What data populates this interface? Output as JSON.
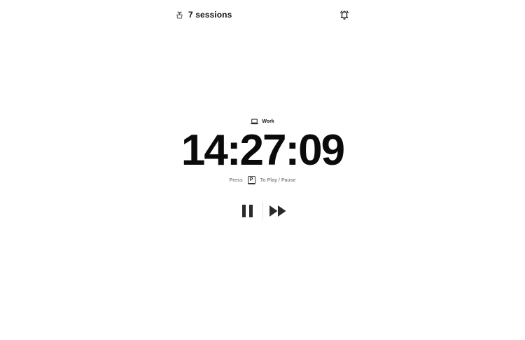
{
  "header": {
    "sessions_label": "7 sessions",
    "sessions_icon": "sprout-pot-icon",
    "notification_icon": "bell-ringing-icon"
  },
  "mode": {
    "label": "Work",
    "icon": "laptop-icon"
  },
  "timer": {
    "display": "14:27:09"
  },
  "hint": {
    "prefix": "Press",
    "key": "P",
    "suffix": "To Play / Pause"
  },
  "controls": {
    "pause_icon": "pause-icon",
    "skip_icon": "fast-forward-icon"
  },
  "colors": {
    "text": "#111111",
    "muted": "#8a8a8a",
    "background": "#ffffff"
  }
}
